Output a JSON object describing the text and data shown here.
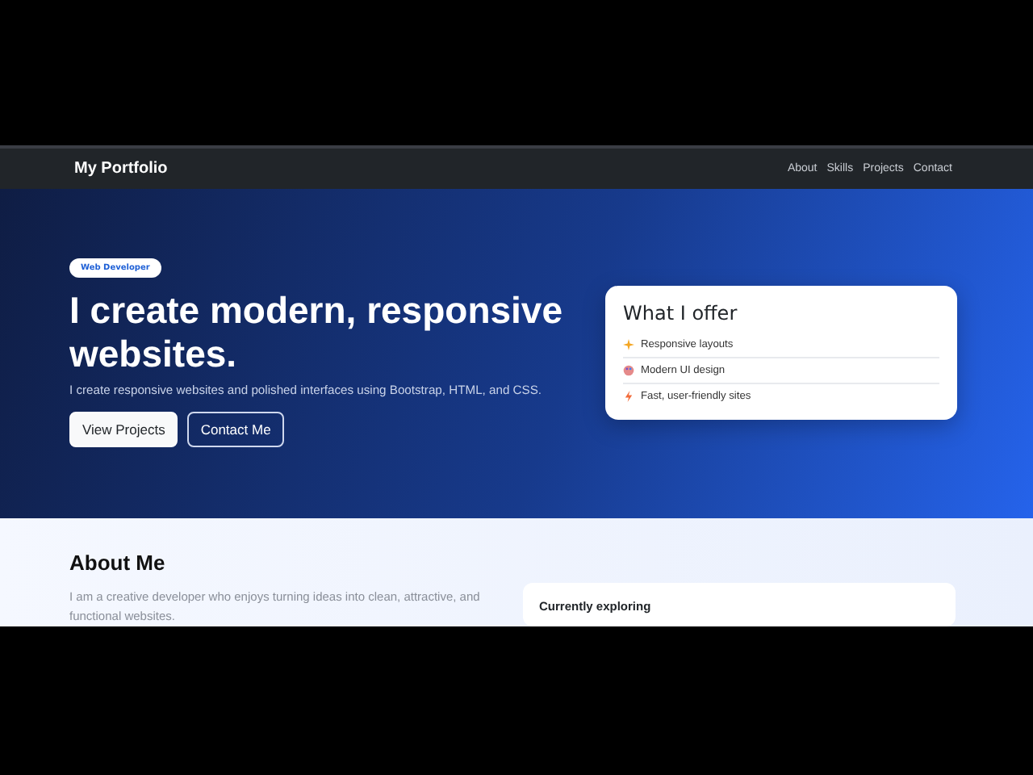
{
  "navbar": {
    "brand": "My Portfolio",
    "links": [
      "About",
      "Skills",
      "Projects",
      "Contact"
    ]
  },
  "hero": {
    "badge": "Web Developer",
    "title": "I create modern, responsive websites.",
    "subtitle": "I create responsive websites and polished interfaces using Bootstrap, HTML, and CSS.",
    "buttons": [
      {
        "label": "View Projects",
        "kind": "primary"
      },
      {
        "label": "Contact Me",
        "kind": "outline"
      }
    ],
    "offer_card": {
      "title": "What I offer",
      "items": [
        {
          "label": "Responsive layouts",
          "kind": "sparkle"
        },
        {
          "label": "Modern UI design",
          "kind": "palette"
        },
        {
          "label": "Fast, user-friendly sites",
          "kind": "bolt"
        }
      ]
    }
  },
  "about": {
    "title": "About Me",
    "text": "I am a creative developer who enjoys turning ideas into clean, attractive, and functional websites.",
    "card_title": "Currently exploring"
  }
}
